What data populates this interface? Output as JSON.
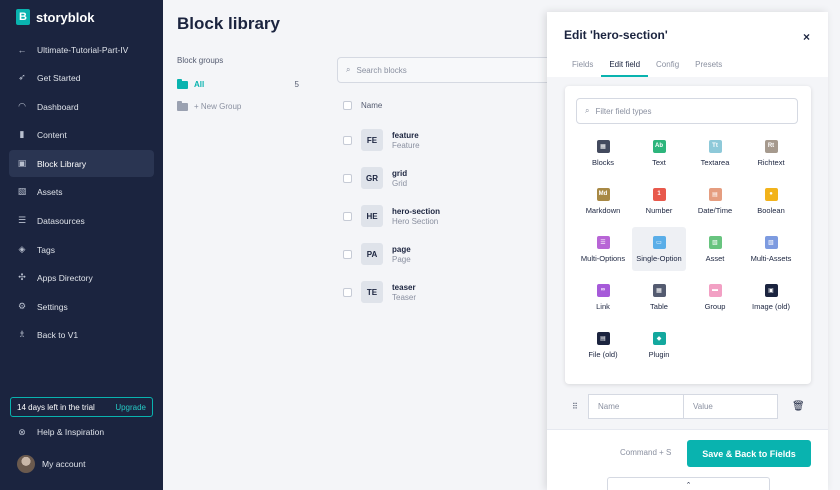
{
  "brand": {
    "name": "storyblok",
    "mark": "B",
    "accent": "#09b3af",
    "sidebar_bg": "#1b243f"
  },
  "sidebar": {
    "items": [
      {
        "label": "Ultimate-Tutorial-Part-IV",
        "icon": "arrow-left-icon"
      },
      {
        "label": "Get Started",
        "icon": "rocket-icon"
      },
      {
        "label": "Dashboard",
        "icon": "gauge-icon"
      },
      {
        "label": "Content",
        "icon": "content-icon"
      },
      {
        "label": "Block Library",
        "icon": "blocks-icon"
      },
      {
        "label": "Assets",
        "icon": "assets-icon"
      },
      {
        "label": "Datasources",
        "icon": "datasources-icon"
      },
      {
        "label": "Tags",
        "icon": "tag-icon"
      },
      {
        "label": "Apps Directory",
        "icon": "apps-icon"
      },
      {
        "label": "Settings",
        "icon": "gear-icon"
      },
      {
        "label": "Back to V1",
        "icon": "v1-icon"
      }
    ],
    "trial": {
      "text": "14 days left in the trial",
      "upgrade": "Upgrade"
    },
    "help": "Help & Inspiration",
    "account": "My account"
  },
  "main": {
    "title": "Block library",
    "groups_title": "Block groups",
    "groups": [
      {
        "label": "All",
        "count": "5"
      },
      {
        "label": "+ New Group",
        "count": ""
      }
    ],
    "search_placeholder": "Search blocks",
    "table_header": "Name",
    "blocks": [
      {
        "badge": "FE",
        "name": "feature",
        "display": "Feature"
      },
      {
        "badge": "GR",
        "name": "grid",
        "display": "Grid"
      },
      {
        "badge": "HE",
        "name": "hero-section",
        "display": "Hero Section"
      },
      {
        "badge": "PA",
        "name": "page",
        "display": "Page"
      },
      {
        "badge": "TE",
        "name": "teaser",
        "display": "Teaser"
      }
    ]
  },
  "drawer": {
    "title": "Edit 'hero-section'",
    "close": "×",
    "tabs": [
      "Fields",
      "Edit field",
      "Config",
      "Presets"
    ],
    "active_tab": "Edit field",
    "filter_placeholder": "Filter field types",
    "field_types": [
      {
        "label": "Blocks",
        "glyph": "▦",
        "color": "#434a5e",
        "icon": "blocks-type-icon"
      },
      {
        "label": "Text",
        "glyph": "Ab",
        "color": "#2db57c",
        "icon": "text-type-icon"
      },
      {
        "label": "Textarea",
        "glyph": "Tt",
        "color": "#8ec9d9",
        "icon": "textarea-type-icon"
      },
      {
        "label": "Richtext",
        "glyph": "Rt",
        "color": "#a69a8e",
        "icon": "richtext-type-icon"
      },
      {
        "label": "Markdown",
        "glyph": "Md",
        "color": "#a88945",
        "icon": "markdown-type-icon"
      },
      {
        "label": "Number",
        "glyph": "1",
        "color": "#e8594c",
        "icon": "number-type-icon"
      },
      {
        "label": "Date/Time",
        "glyph": "▤",
        "color": "#e59d80",
        "icon": "datetime-type-icon"
      },
      {
        "label": "Boolean",
        "glyph": "●",
        "color": "#f2b31b",
        "icon": "boolean-type-icon"
      },
      {
        "label": "Multi-Options",
        "glyph": "☰",
        "color": "#b865d6",
        "icon": "multi-options-type-icon"
      },
      {
        "label": "Single-Option",
        "glyph": "▭",
        "color": "#5aaee8",
        "icon": "single-option-type-icon"
      },
      {
        "label": "Asset",
        "glyph": "▧",
        "color": "#68c47f",
        "icon": "asset-type-icon"
      },
      {
        "label": "Multi-Assets",
        "glyph": "▧",
        "color": "#7d9be0",
        "icon": "multi-assets-type-icon"
      },
      {
        "label": "Link",
        "glyph": "∞",
        "color": "#a65ad9",
        "icon": "link-type-icon"
      },
      {
        "label": "Table",
        "glyph": "▦",
        "color": "#545b70",
        "icon": "table-type-icon"
      },
      {
        "label": "Group",
        "glyph": "▬",
        "color": "#f2a0c4",
        "icon": "group-type-icon"
      },
      {
        "label": "Image (old)",
        "glyph": "▣",
        "color": "#1b243f",
        "icon": "image-old-type-icon"
      },
      {
        "label": "File (old)",
        "glyph": "▤",
        "color": "#1b243f",
        "icon": "file-old-type-icon"
      },
      {
        "label": "Plugin",
        "glyph": "◆",
        "color": "#13a89e",
        "icon": "plugin-type-icon"
      }
    ],
    "hovered_type": "Single-Option",
    "option": {
      "name_placeholder": "Name",
      "value_placeholder": "Value"
    },
    "hint": "Command + S",
    "save_label": "Save & Back to Fields",
    "scroll_glyph": "⌃"
  }
}
